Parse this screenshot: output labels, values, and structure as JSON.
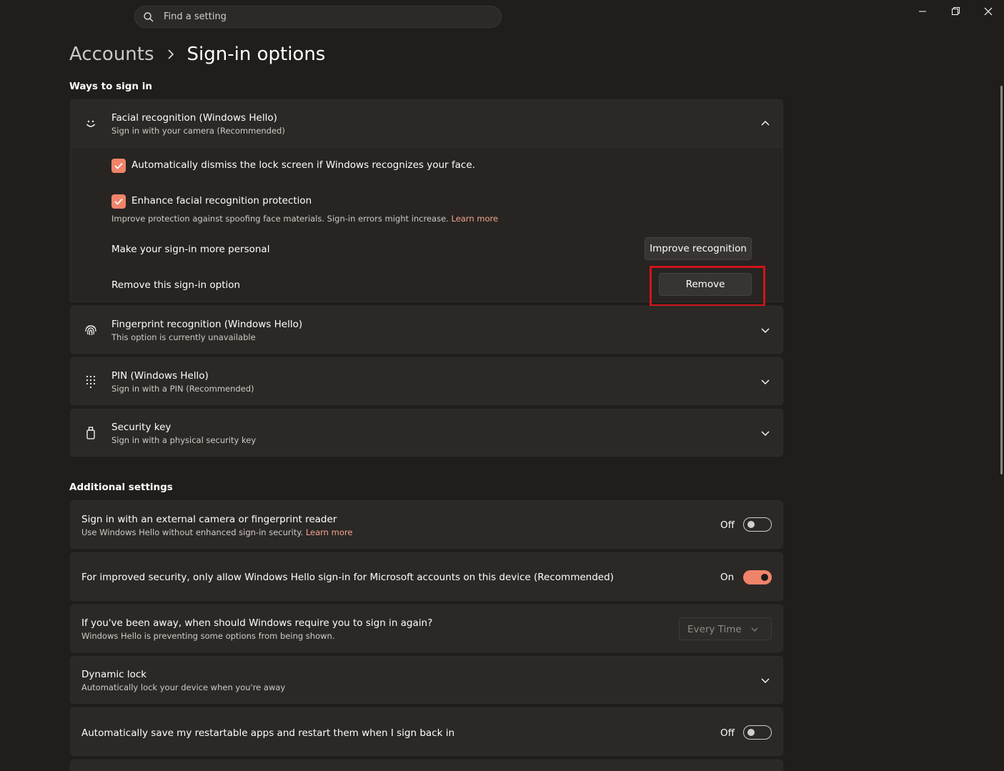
{
  "search": {
    "placeholder": "Find a setting"
  },
  "breadcrumb": {
    "parent": "Accounts",
    "current": "Sign-in options"
  },
  "ways_section": {
    "title": "Ways to sign in"
  },
  "facial": {
    "title": "Facial recognition (Windows Hello)",
    "subtitle": "Sign in with your camera (Recommended)",
    "option1": "Automatically dismiss the lock screen if Windows recognizes your face.",
    "option1_checked": true,
    "option2": "Enhance facial recognition protection",
    "option2_checked": true,
    "option2_desc": "Improve protection against spoofing face materials. Sign-in errors might increase.",
    "option2_link": "Learn more",
    "personal_label": "Make your sign-in more personal",
    "improve_button": "Improve recognition",
    "remove_label": "Remove this sign-in option",
    "remove_button": "Remove"
  },
  "fingerprint": {
    "title": "Fingerprint recognition (Windows Hello)",
    "subtitle": "This option is currently unavailable"
  },
  "pin": {
    "title": "PIN (Windows Hello)",
    "subtitle": "Sign in with a PIN (Recommended)"
  },
  "security_key": {
    "title": "Security key",
    "subtitle": "Sign in with a physical security key"
  },
  "additional_section": {
    "title": "Additional settings"
  },
  "external_camera": {
    "title": "Sign in with an external camera or fingerprint reader",
    "subtitle": "Use Windows Hello without enhanced sign-in security.",
    "link": "Learn more",
    "state": "Off"
  },
  "hello_only": {
    "title": "For improved security, only allow Windows Hello sign-in for Microsoft accounts on this device (Recommended)",
    "state": "On"
  },
  "require_signin": {
    "title": "If you've been away, when should Windows require you to sign in again?",
    "subtitle": "Windows Hello is preventing some options from being shown.",
    "selected": "Every Time"
  },
  "dynamic_lock": {
    "title": "Dynamic lock",
    "subtitle": "Automatically lock your device when you're away"
  },
  "restart_apps": {
    "title": "Automatically save my restartable apps and restart them when I sign back in",
    "state": "Off"
  },
  "colors": {
    "accent": "#f0846a",
    "background": "#201d1b",
    "card": "#2b2826",
    "highlight": "#d3131b"
  }
}
